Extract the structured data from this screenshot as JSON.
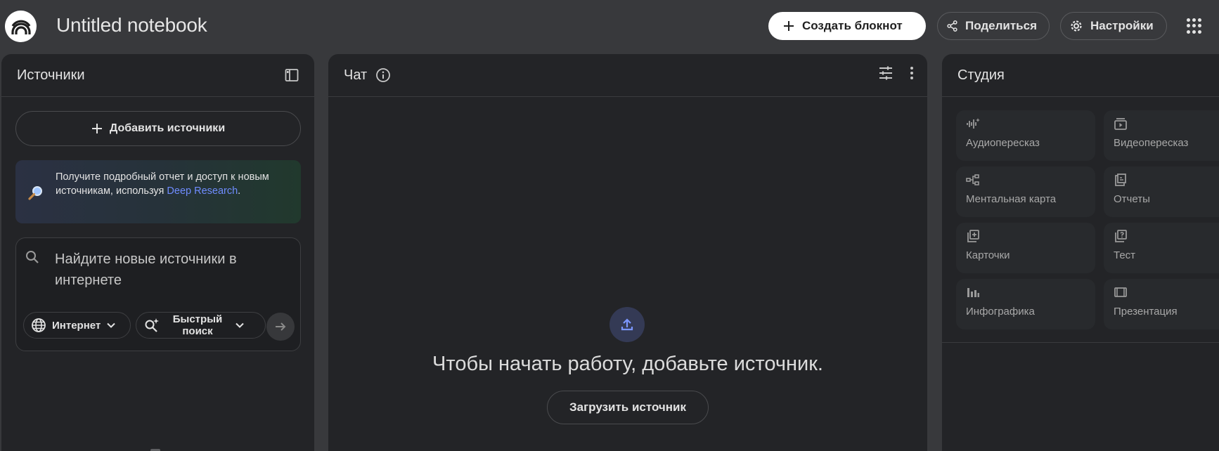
{
  "header": {
    "title": "Untitled notebook",
    "create_label": "Создать блокнот",
    "share_label": "Поделиться",
    "settings_label": "Настройки",
    "icons": [
      "notebooklm-logo-icon",
      "plus-icon",
      "share-icon",
      "gear-icon",
      "apps-grid-icon"
    ]
  },
  "sources": {
    "title": "Источники",
    "add_label": "Добавить источники",
    "promo": {
      "text": "Получите подробный отчет и доступ к новым источникам, используя",
      "link": "Deep Research",
      "end": "."
    },
    "search": {
      "text": "Найдите новые источники в интернете",
      "web_label": "Интернет",
      "fast_label": "Быстрый поиск"
    }
  },
  "chat": {
    "title": "Чат",
    "empty_message": "Чтобы начать работу, добавьте источник.",
    "upload_label": "Загрузить источник"
  },
  "studio": {
    "title": "Студия",
    "tiles": [
      {
        "label": "Аудиопересказ",
        "icon": "audio-waveform-icon"
      },
      {
        "label": "Видеопересказ",
        "icon": "video-icon"
      },
      {
        "label": "Ментальная карта",
        "icon": "mind-map-icon"
      },
      {
        "label": "Отчеты",
        "icon": "report-icon"
      },
      {
        "label": "Карточки",
        "icon": "flashcards-icon"
      },
      {
        "label": "Тест",
        "icon": "quiz-icon"
      },
      {
        "label": "Инфографика",
        "icon": "infographic-icon"
      },
      {
        "label": "Презентация",
        "icon": "presentation-icon"
      }
    ]
  },
  "colors": {
    "background": "#38393c",
    "panel": "#232427",
    "accent_link": "#6f8cff",
    "primary_button": "#ffffff"
  }
}
